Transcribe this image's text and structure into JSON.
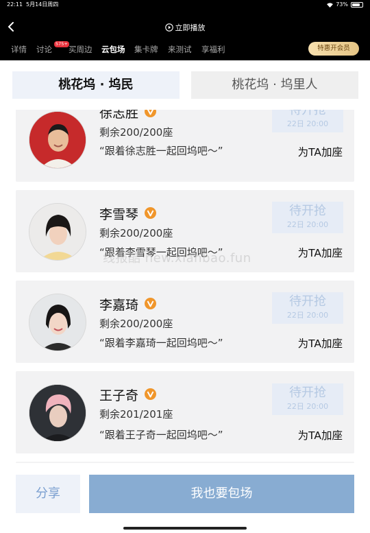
{
  "status_bar": {
    "time": "22:11",
    "date": "5月14日周四",
    "battery": "73%"
  },
  "topbar": {
    "title": "立即播放"
  },
  "tabs": [
    {
      "label": "详情"
    },
    {
      "label": "讨论",
      "badge": "575+"
    },
    {
      "label": "买周边"
    },
    {
      "label": "云包场"
    },
    {
      "label": "集卡牌"
    },
    {
      "label": "来测试"
    },
    {
      "label": "享福利"
    }
  ],
  "vip_button": "特惠开会员",
  "segments": {
    "left": "桃花坞 · 坞民",
    "right": "桃花坞 · 坞里人"
  },
  "cards": [
    {
      "name": "徐志胜",
      "remain": "剩余200/200座",
      "quote": "“跟着徐志胜一起回坞吧～”",
      "status": "待开抢",
      "time": "22日 20:00",
      "action": "为TA加座"
    },
    {
      "name": "李雪琴",
      "remain": "剩余200/200座",
      "quote": "“跟着李雪琴一起回坞吧～”",
      "status": "待开抢",
      "time": "22日 20:00",
      "action": "为TA加座"
    },
    {
      "name": "李嘉琦",
      "remain": "剩余200/200座",
      "quote": "“跟着李嘉琦一起回坞吧～”",
      "status": "待开抢",
      "time": "22日 20:00",
      "action": "为TA加座"
    },
    {
      "name": "王子奇",
      "remain": "剩余201/201座",
      "quote": "“跟着王子奇一起回坞吧～”",
      "status": "待开抢",
      "time": "22日 20:00",
      "action": "为TA加座"
    }
  ],
  "watermark": "线报酷 new.xianbao.fun",
  "bottom": {
    "share": "分享",
    "book": "我也要包场"
  },
  "colors": {
    "accent": "#88acd2",
    "verify": "#f0962b",
    "vip": "#e6c585"
  }
}
